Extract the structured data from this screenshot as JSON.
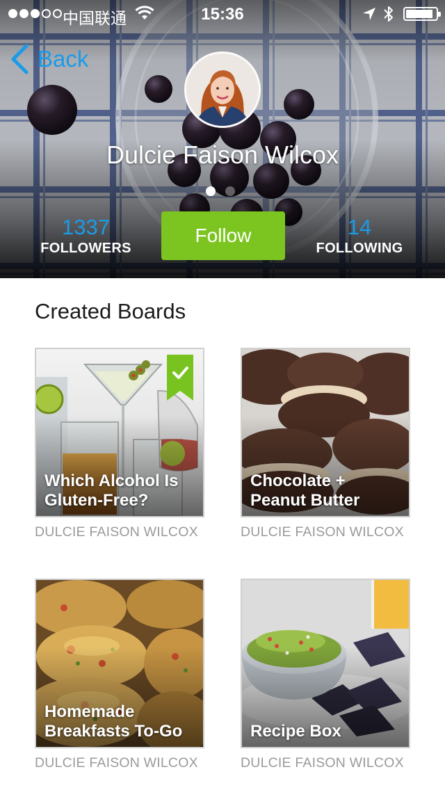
{
  "status_bar": {
    "carrier": "中国联通",
    "time": "15:36",
    "signal_bars_filled": 3,
    "signal_bars_total": 5,
    "battery_level": 0.9
  },
  "nav": {
    "back_label": "Back",
    "back_icon": "chevron-left-icon"
  },
  "profile": {
    "name": "Dulcie Faison Wilcox",
    "followers_count": "1337",
    "followers_label": "FOLLOWERS",
    "following_count": "14",
    "following_label": "FOLLOWING",
    "follow_button_label": "Follow",
    "page_count": 2,
    "active_page": 0
  },
  "section": {
    "title": "Created Boards"
  },
  "boards": [
    {
      "title": "Which Alcohol Is Gluten-Free?",
      "owner": "DULCIE FAISON WILCOX",
      "bookmarked": true
    },
    {
      "title": "Chocolate + Peanut Butter",
      "owner": "DULCIE FAISON WILCOX",
      "bookmarked": false
    },
    {
      "title": "Homemade Breakfasts To-Go",
      "owner": "DULCIE FAISON WILCOX",
      "bookmarked": false
    },
    {
      "title": "Recipe Box",
      "owner": "DULCIE FAISON WILCOX",
      "bookmarked": false
    }
  ],
  "colors": {
    "accent_blue": "#1a9be8",
    "follow_green": "#7cc520",
    "bookmark_green": "#78c31f",
    "owner_gray": "#9a9a9a"
  }
}
